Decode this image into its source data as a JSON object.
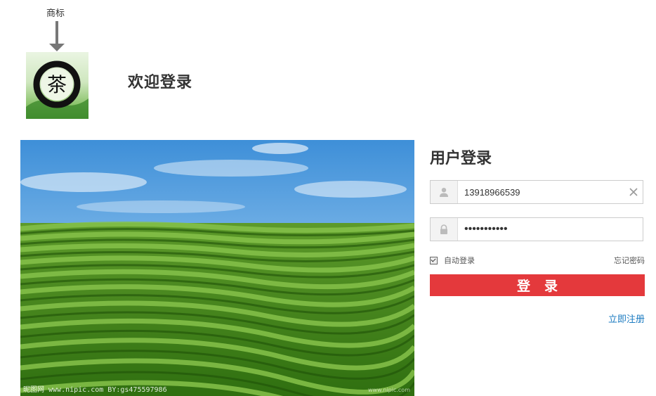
{
  "annotation": {
    "label": "商标"
  },
  "logo": {
    "icon": "tea-logo-icon",
    "character": "茶"
  },
  "header": {
    "welcome": "欢迎登录"
  },
  "photo": {
    "watermark": "昵图网 www.nipic.com  BY:gs475597986",
    "watermark_right": "www.nipic.com"
  },
  "login": {
    "title": "用户登录",
    "username": {
      "value": "13918966539",
      "icon": "user-icon"
    },
    "password": {
      "value": "•••••••••••",
      "icon": "lock-icon"
    },
    "auto_login_label": "自动登录",
    "forgot_label": "忘记密码",
    "submit_label": "登录",
    "register_label": "立即注册"
  },
  "colors": {
    "accent": "#e4393c",
    "link": "#1a7ac0"
  }
}
